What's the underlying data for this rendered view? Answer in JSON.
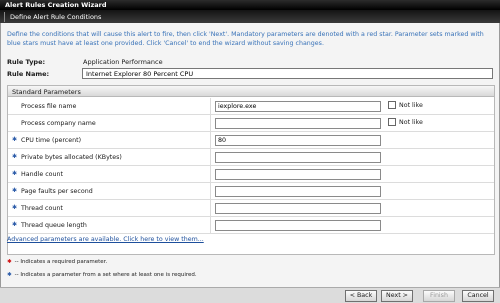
{
  "window": {
    "title": "Alert Rules Creation Wizard"
  },
  "wizard_step": {
    "label": "Define Alert Rule Conditions"
  },
  "instructions": "Define the conditions that will cause this alert to fire, then click 'Next'. Mandatory parameters are denoted with a red star. Parameter sets marked with blue stars must have at least one provided. Click 'Cancel' to end the wizard without saving changes.",
  "rule_type": {
    "label": "Rule Type:",
    "value": "Application Performance"
  },
  "rule_name": {
    "label": "Rule Name:",
    "value": "Internet Explorer 80 Percent CPU"
  },
  "standard_parameters": {
    "header": "Standard Parameters",
    "rows": [
      {
        "label": "Process file name",
        "starred": false,
        "value": "iexplore.exe",
        "not_like": true,
        "not_like_label": "Not like"
      },
      {
        "label": "Process company name",
        "starred": false,
        "value": "",
        "not_like": true,
        "not_like_label": "Not like"
      },
      {
        "label": "CPU time (percent)",
        "starred": true,
        "value": "80",
        "not_like": false
      },
      {
        "label": "Private bytes allocated (KBytes)",
        "starred": true,
        "value": "",
        "not_like": false
      },
      {
        "label": "Handle count",
        "starred": true,
        "value": "",
        "not_like": false
      },
      {
        "label": "Page faults per second",
        "starred": true,
        "value": "",
        "not_like": false
      },
      {
        "label": "Thread count",
        "starred": true,
        "value": "",
        "not_like": false
      },
      {
        "label": "Thread queue length",
        "starred": true,
        "value": "",
        "not_like": false
      }
    ]
  },
  "advanced_link": "Advanced parameters are available. Click here to view them...",
  "legend": {
    "required": "-- Indicates a required parameter.",
    "set": "-- Indicates a parameter from a set where at least one is required.",
    "required_color": "#d01010",
    "set_color": "#2a5aa8"
  },
  "buttons": {
    "back": "< Back",
    "next": "Next >",
    "finish": "Finish",
    "cancel": "Cancel"
  }
}
